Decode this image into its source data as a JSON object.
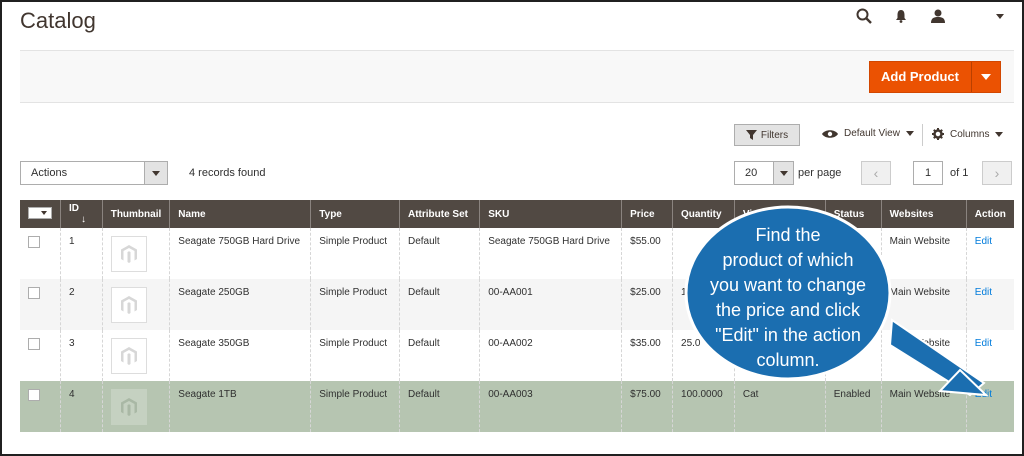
{
  "header": {
    "title": "Catalog"
  },
  "toolbar": {
    "add_product_label": "Add Product",
    "filters_label": "Filters",
    "view_label": "Default View",
    "columns_label": "Columns"
  },
  "grid_controls": {
    "actions_label": "Actions",
    "records_found": "4 records found",
    "per_page_value": "20",
    "per_page_label": "per page",
    "current_page": "1",
    "of_pages": "of 1"
  },
  "table": {
    "headers": [
      "ID",
      "Thumbnail",
      "Name",
      "Type",
      "Attribute Set",
      "SKU",
      "Price",
      "Quantity",
      "Visibility",
      "Status",
      "Websites",
      "Action"
    ],
    "rows": [
      {
        "id": "1",
        "name": "Seagate 750GB Hard Drive",
        "type": "Simple Product",
        "attr": "Default",
        "sku": "Seagate 750GB Hard Drive",
        "price": "$55.00",
        "qty": "",
        "visibility": "",
        "status": "",
        "websites": "Main Website",
        "action": "Edit"
      },
      {
        "id": "2",
        "name": "Seagate 250GB",
        "type": "Simple Product",
        "attr": "Default",
        "sku": "00-AA001",
        "price": "$25.00",
        "qty": "1",
        "visibility": "",
        "status": "",
        "websites": "Main Website",
        "action": "Edit"
      },
      {
        "id": "3",
        "name": "Seagate 350GB",
        "type": "Simple Product",
        "attr": "Default",
        "sku": "00-AA002",
        "price": "$35.00",
        "qty": "25.0",
        "visibility": "",
        "status": "",
        "websites": "Main Website",
        "action": "Edit"
      },
      {
        "id": "4",
        "name": "Seagate 1TB",
        "type": "Simple Product",
        "attr": "Default",
        "sku": "00-AA003",
        "price": "$75.00",
        "qty": "100.0000",
        "visibility": "Cat",
        "status": "Enabled",
        "websites": "Main Website",
        "action": "Edit"
      }
    ]
  },
  "callout": {
    "lines": [
      "Find the",
      "product of which",
      "you want to change",
      "the price and click",
      "\"Edit\" in the action",
      "column."
    ]
  },
  "colors": {
    "accent": "#eb5202",
    "header_bg": "#514943",
    "highlight_row": "#b6c5b1",
    "callout": "#1b6eb0",
    "link": "#007bdb"
  }
}
